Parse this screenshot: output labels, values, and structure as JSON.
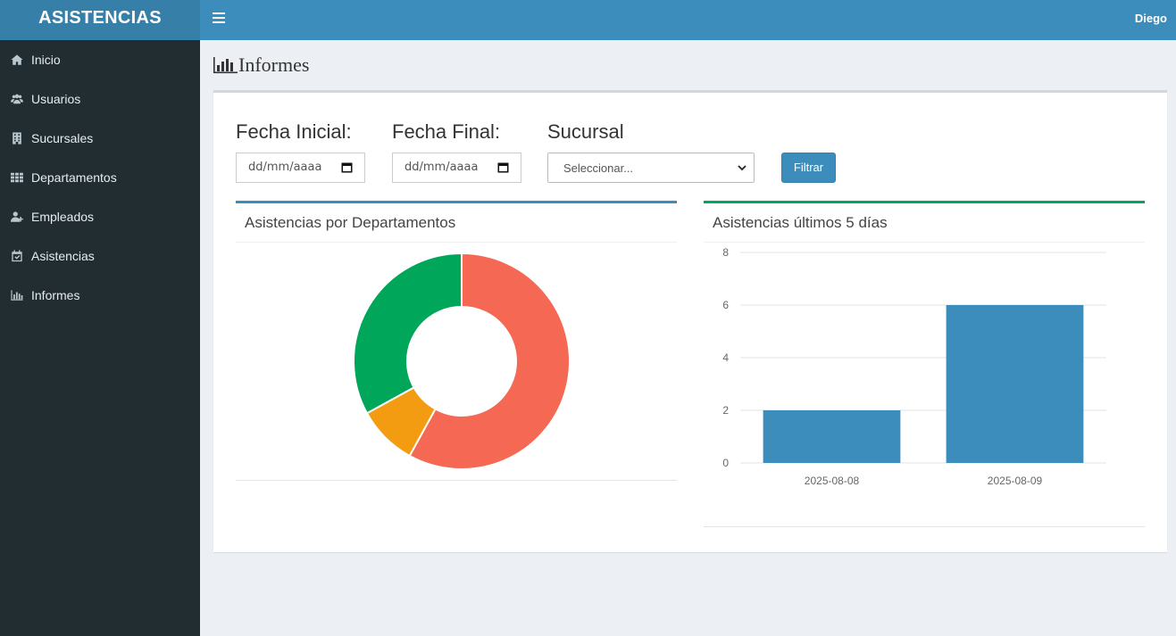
{
  "app": {
    "title": "ASISTENCIAS",
    "user": "Diego"
  },
  "sidebar": {
    "items": [
      {
        "label": "Inicio",
        "icon": "home-icon"
      },
      {
        "label": "Usuarios",
        "icon": "users-icon"
      },
      {
        "label": "Sucursales",
        "icon": "building-icon"
      },
      {
        "label": "Departamentos",
        "icon": "grid-icon"
      },
      {
        "label": "Empleados",
        "icon": "user-plus-icon"
      },
      {
        "label": "Asistencias",
        "icon": "calendar-check-icon"
      },
      {
        "label": "Informes",
        "icon": "bar-chart-icon"
      }
    ]
  },
  "page": {
    "title": "Informes"
  },
  "filters": {
    "start_label": "Fecha Inicial:",
    "start_placeholder": "dd/mm/aaaa",
    "end_label": "Fecha Final:",
    "end_placeholder": "dd/mm/aaaa",
    "branch_label": "Sucursal",
    "branch_selected": "Seleccionar...",
    "filter_button": "Filtrar"
  },
  "colors": {
    "primary": "#3c8dbc",
    "success": "#00a65a",
    "danger": "#f56954",
    "warning": "#f39c12"
  },
  "chart_data": [
    {
      "type": "pie",
      "title": "Asistencias por Departamentos",
      "slices": [
        {
          "value": 58,
          "color": "#f56954"
        },
        {
          "value": 9,
          "color": "#f39c12"
        },
        {
          "value": 33,
          "color": "#00a65a"
        }
      ],
      "donut": true
    },
    {
      "type": "bar",
      "title": "Asistencias últimos 5 días",
      "categories": [
        "2025-08-08",
        "2025-08-09"
      ],
      "values": [
        2,
        6
      ],
      "ylim": [
        0,
        8
      ],
      "yticks": [
        "0",
        "2",
        "4",
        "6",
        "8"
      ],
      "grid": true,
      "color": "#3c8dbc"
    }
  ]
}
